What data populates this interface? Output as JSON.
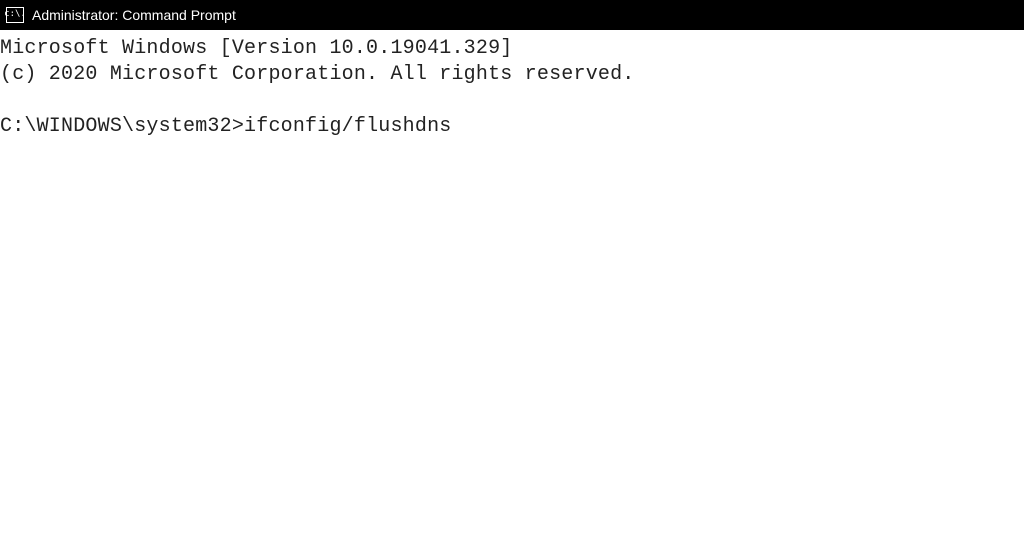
{
  "title_bar": {
    "icon_label": "c:\\.",
    "title": "Administrator: Command Prompt"
  },
  "console": {
    "line1": "Microsoft Windows [Version 10.0.19041.329]",
    "line2": "(c) 2020 Microsoft Corporation. All rights reserved.",
    "prompt": "C:\\WINDOWS\\system32>",
    "command": "ifconfig/flushdns"
  }
}
